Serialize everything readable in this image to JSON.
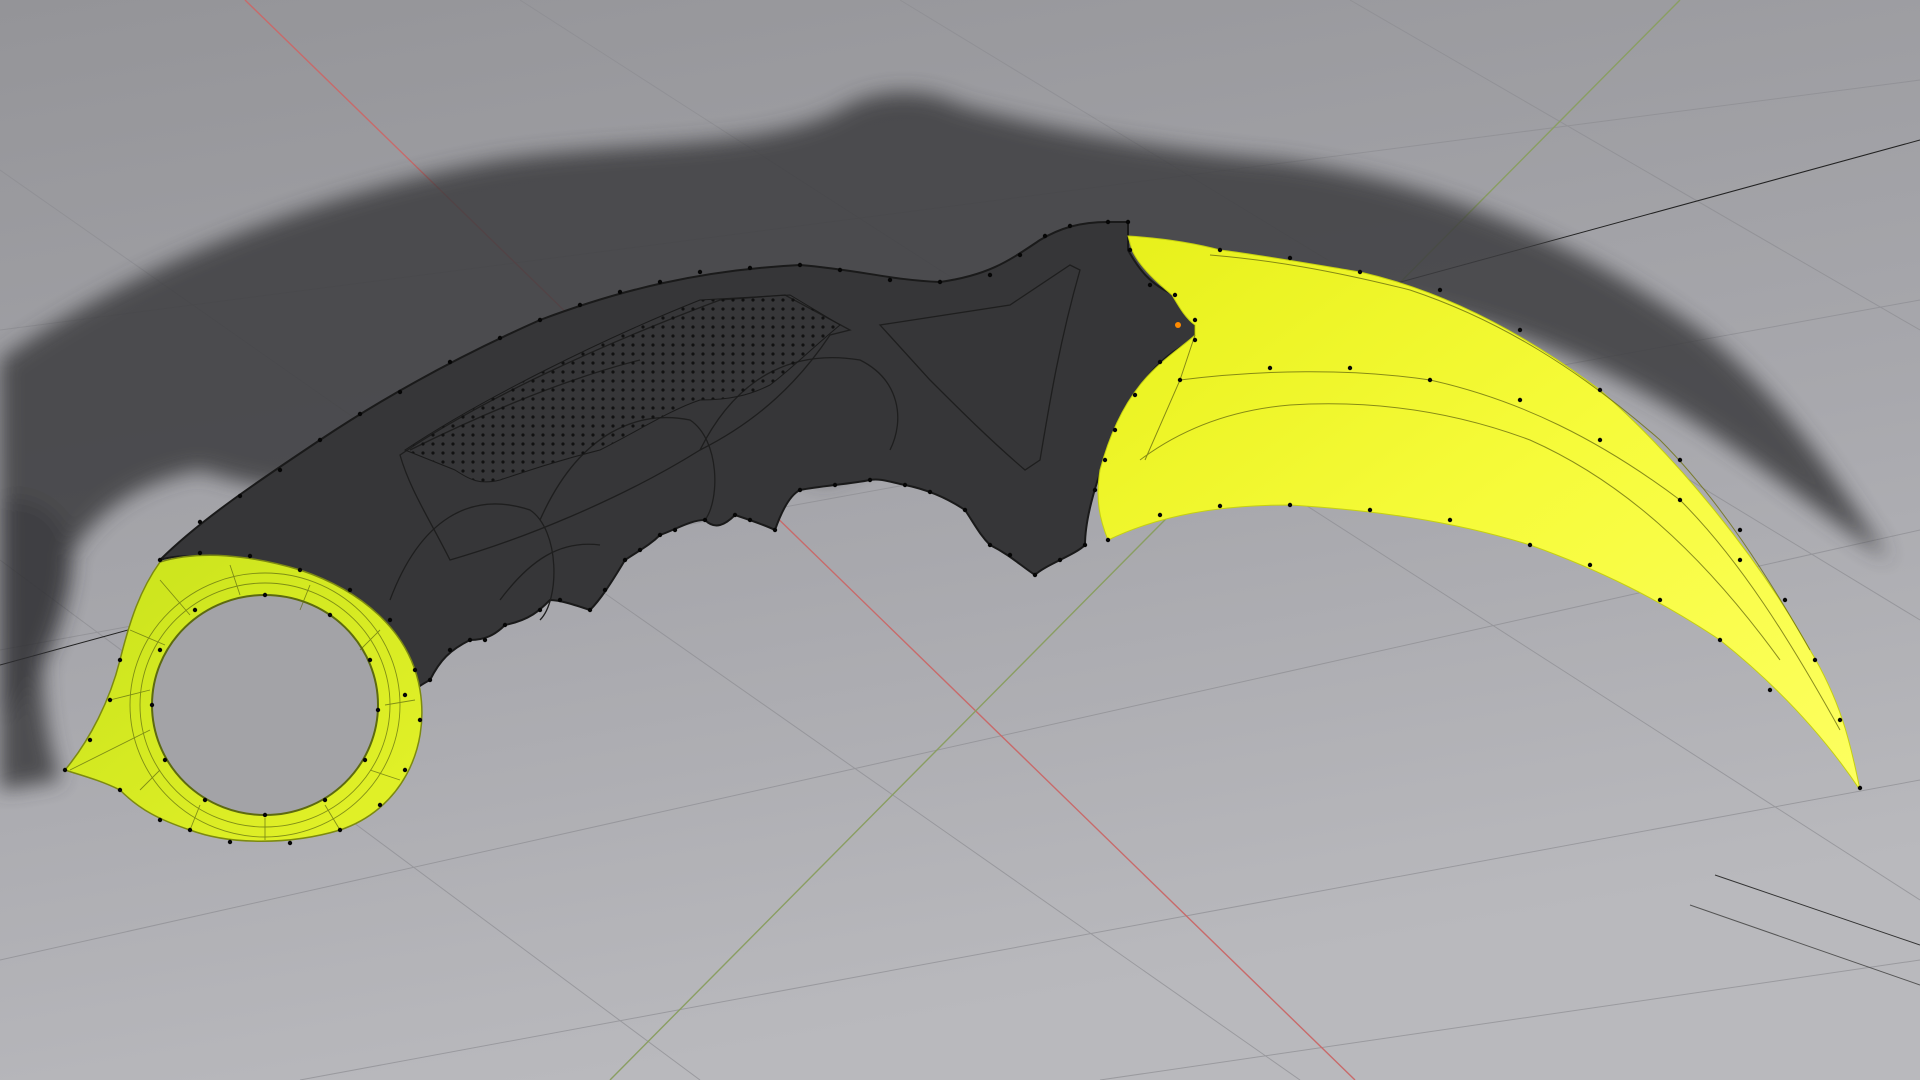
{
  "viewport": {
    "background_top": "#9b9b9f",
    "background_bottom": "#b6b6ba",
    "grid_color": "#8c8c90",
    "x_axis_color": "#c86a6a",
    "y_axis_color": "#8a9e62"
  },
  "model": {
    "handle_color": "#353537",
    "handle_edge_color": "#1b1b1b",
    "blade_color": "#f0f72a",
    "blade_highlight": "#fbff55",
    "ring_color": "#d4e820",
    "shadow_color": "#3a3a3c",
    "vertex_color": "#050505",
    "active_vertex_color": "#ff8a00"
  },
  "icons": {
    "object_origin": "origin-icon"
  }
}
